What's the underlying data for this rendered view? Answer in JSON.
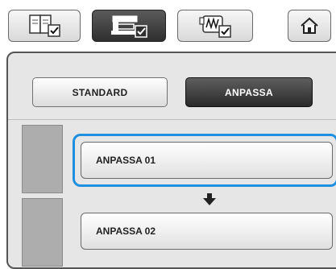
{
  "toolbar": {
    "buttons": [
      {
        "id": "manual",
        "icon": "book-check-icon",
        "active": false
      },
      {
        "id": "embroidery",
        "icon": "embroidery-machine-check-icon",
        "active": true
      },
      {
        "id": "sewing",
        "icon": "sewing-pattern-check-icon",
        "active": false
      },
      {
        "id": "home",
        "icon": "home-icon",
        "active": false
      }
    ]
  },
  "mode": {
    "standard_label": "STANDARD",
    "anpassa_label": "ANPASSA",
    "selected": "ANPASSA"
  },
  "list": {
    "items": [
      {
        "label": "ANPASSA 01",
        "selected": true
      },
      {
        "label": "ANPASSA 02",
        "selected": false
      }
    ]
  },
  "colors": {
    "selection_ring": "#1f8fe0",
    "active_button": "#3a3a3a",
    "panel_background": "#e6e6e6"
  }
}
